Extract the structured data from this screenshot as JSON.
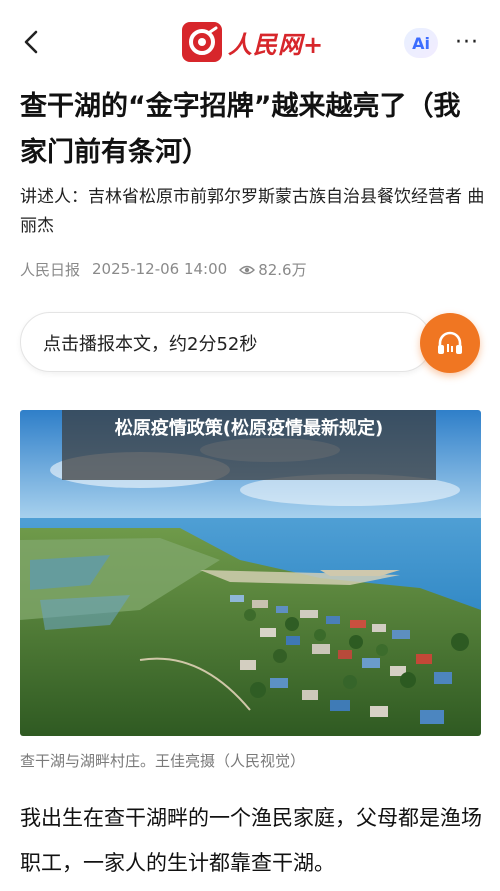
{
  "header": {
    "back_icon": "chevron-left-icon",
    "logo_text": "人民网+",
    "ai_label": "Ai",
    "more_label": "···",
    "brand_color": "#d7262b"
  },
  "article": {
    "title": "查干湖的“金字招牌”越来越亮了（我家门前有条河）",
    "narrator": "讲述人：吉林省松原市前郭尔罗斯蒙古族自治县餐饮经营者 曲丽杰",
    "source": "人民日报",
    "datetime": "2025-12-06 14:00",
    "views": "82.6万",
    "audio_prompt": "点击播报本文，约2分52秒",
    "audio_color": "#f07622",
    "image_overlay": "松原疫情政策(松原疫情最新规定)",
    "caption": "查干湖与湖畔村庄。王佳亮摄（人民视觉）",
    "body": "我出生在查干湖畔的一个渔民家庭，父母都是渔场职工，一家人的生计都靠查干湖。"
  }
}
